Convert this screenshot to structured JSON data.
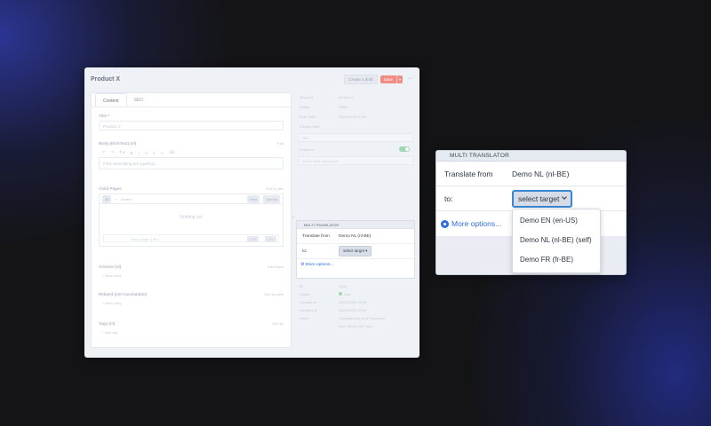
{
  "window": {
    "title": "Product X",
    "create_draft_label": "Create a draft",
    "save_label": "Save",
    "save_caret": "▾",
    "more_label": "···"
  },
  "editor": {
    "tabs": [
      "Content",
      "SEO"
    ],
    "fields": {
      "title_label": "Title",
      "title_value": "Product X",
      "desc_label": "Body (RichText) (nl)",
      "desc_side": "Edit",
      "desc_placeholder": "Fill in describing text (quill-js)...",
      "pages_label": "Child Pages",
      "pages_side": "Sort by title",
      "pages_chip_all": "All",
      "pages_search": "Search",
      "pages_chip_a": "New",
      "pages_chip_b": "Sort by",
      "pages_nothing": "Nothing yet",
      "pages_add_url": "Add a page (URL)",
      "pages_add_btn": "Add",
      "pages_link_btn": "Link",
      "content_label": "Content (nl)",
      "content_side": "Add Block",
      "content_new": "+ New entry",
      "related_label": "Related (not translatable)",
      "related_side": "Sort by date",
      "related_new": "+ New entry",
      "tags_label": "Tags (nl)",
      "tags_side": "Sort by",
      "tags_new": "+ Add tag"
    }
  },
  "meta": {
    "rows": [
      {
        "k": "Slug (nl)",
        "v": "product-x"
      },
      {
        "k": "Author",
        "v": "Editor"
      },
      {
        "k": "Pub. Date",
        "v": "01/01/2024     12:00"
      },
      {
        "k": "Display Date",
        "v": ""
      }
    ],
    "section_label": "SEO",
    "featured_label": "Featured",
    "faint_input": "Add a short description"
  },
  "mini_translator": {
    "header": "MULTI TRANSLATOR",
    "from_label": "Translate from",
    "from_value": "Demo NL (nl-BE)",
    "to_label": "to:",
    "select_label": "select target",
    "more_options": "More options..."
  },
  "lower_meta": {
    "rows": [
      {
        "k": "ID",
        "v": "1234"
      },
      {
        "k": "Status",
        "v": "Live"
      },
      {
        "k": "Created at",
        "v": "01/01/2024 12:00"
      },
      {
        "k": "Updated at",
        "v": "01/01/2024 12:00"
      },
      {
        "k": "Notes",
        "v": "Translated by Multi Translator"
      },
      {
        "k": "",
        "v": "from \"Demo EN\" (en)"
      }
    ]
  },
  "translator": {
    "header": "MULTI TRANSLATOR",
    "from_label": "Translate from",
    "from_value": "Demo NL (nl-BE)",
    "to_label": "to:",
    "select_label": "select target",
    "more_options": "More options...",
    "options": [
      "Demo EN (en-US)",
      "Demo NL (nl-BE) (self)",
      "Demo FR (fr-BE)"
    ]
  },
  "colors": {
    "accent": "#2f6fe0",
    "focus_border": "#3a86d4",
    "save_button": "#f28b82",
    "toggle_on": "#9fd8b0"
  }
}
